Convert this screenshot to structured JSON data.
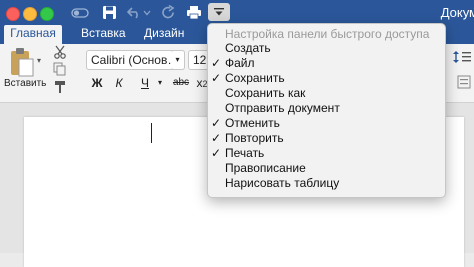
{
  "window": {
    "title": "Докум"
  },
  "tabs": {
    "home": "Главная",
    "insert": "Вставка",
    "design": "Дизайн"
  },
  "ribbon": {
    "paste_label": "Вставить",
    "font_name": "Calibri (Основ…",
    "font_size": "12",
    "bold": "Ж",
    "italic": "К",
    "underline": "Ч",
    "strikethrough": "abc",
    "subscript": "x",
    "subscript_mark": "2"
  },
  "quick_access_menu": {
    "header": "Настройка панели быстрого доступа",
    "items": [
      {
        "label": "Создать",
        "checked": false,
        "check": ""
      },
      {
        "label": "Файл",
        "checked": true,
        "check": "✓"
      },
      {
        "label": "Сохранить",
        "checked": true,
        "check": "✓"
      },
      {
        "label": "Сохранить как",
        "checked": false,
        "check": ""
      },
      {
        "label": "Отправить документ",
        "checked": false,
        "check": ""
      },
      {
        "label": "Отменить",
        "checked": true,
        "check": "✓"
      },
      {
        "label": "Повторить",
        "checked": true,
        "check": "✓"
      },
      {
        "label": "Печать",
        "checked": true,
        "check": "✓"
      },
      {
        "label": "Правописание",
        "checked": false,
        "check": ""
      },
      {
        "label": "Нарисовать таблицу",
        "checked": false,
        "check": ""
      }
    ]
  },
  "colors": {
    "title_bar": "#2b579a",
    "ribbon": "#f3f3f3",
    "menu": "#f2f2f2"
  }
}
